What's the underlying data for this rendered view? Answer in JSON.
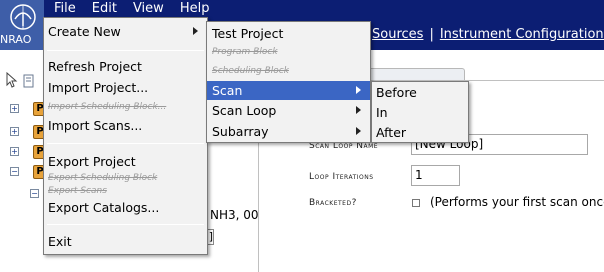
{
  "header": {
    "logo_text": "NRAO",
    "menus": [
      "File",
      "Edit",
      "View",
      "Help"
    ],
    "links": [
      "Sources",
      "Instrument Configurations"
    ],
    "link_separator": "|",
    "colors": {
      "header_bg": "#0c1e73",
      "logo_bg": "#3e5ea8",
      "menu_selected": "#3b66c4"
    }
  },
  "file_menu": {
    "create_new": "Create New",
    "refresh_project": "Refresh Project",
    "import_project": "Import Project...",
    "import_scheduling_block": "Import Scheduling Block...",
    "import_scans": "Import Scans...",
    "export_project": "Export Project",
    "export_scheduling_block": "Export Scheduling Block",
    "export_scans": "Export Scans",
    "export_catalogs": "Export Catalogs...",
    "exit": "Exit"
  },
  "create_menu": {
    "test_project": "Test Project",
    "program_block": "Program Block",
    "scheduling_block": "Scheduling Block",
    "scan": "Scan",
    "scan_loop": "Scan Loop",
    "subarray": "Subarray"
  },
  "scan_menu": {
    "before": "Before",
    "in": "In",
    "after": "After"
  },
  "tree": {
    "toggles": [
      "+",
      "+",
      "+",
      "−"
    ],
    "project_icon_label": "P",
    "partial_text": "NH3, 00",
    "stub_text": "]"
  },
  "form": {
    "scan_loop_name_label": "Scan Loop Name",
    "scan_loop_name_value": "[New Loop]",
    "loop_iterations_label": "Loop Iterations",
    "loop_iterations_value": "1",
    "bracketed_label": "Bracketed?",
    "bracketed_description": "(Performs your first scan once"
  }
}
